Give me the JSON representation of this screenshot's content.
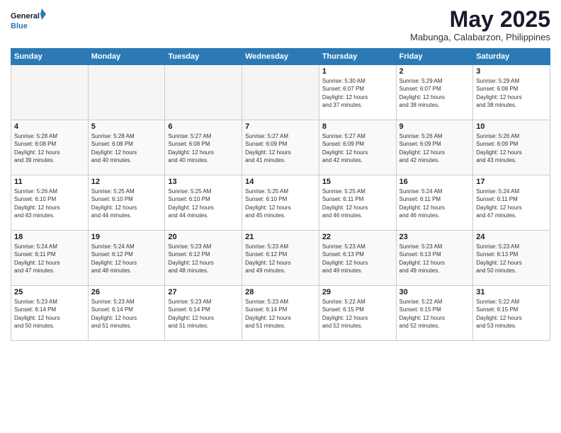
{
  "logo": {
    "line1": "General",
    "line2": "Blue"
  },
  "title": "May 2025",
  "location": "Mabunga, Calabarzon, Philippines",
  "weekdays": [
    "Sunday",
    "Monday",
    "Tuesday",
    "Wednesday",
    "Thursday",
    "Friday",
    "Saturday"
  ],
  "weeks": [
    [
      {
        "day": "",
        "info": ""
      },
      {
        "day": "",
        "info": ""
      },
      {
        "day": "",
        "info": ""
      },
      {
        "day": "",
        "info": ""
      },
      {
        "day": "1",
        "info": "Sunrise: 5:30 AM\nSunset: 6:07 PM\nDaylight: 12 hours\nand 37 minutes."
      },
      {
        "day": "2",
        "info": "Sunrise: 5:29 AM\nSunset: 6:07 PM\nDaylight: 12 hours\nand 38 minutes."
      },
      {
        "day": "3",
        "info": "Sunrise: 5:29 AM\nSunset: 6:08 PM\nDaylight: 12 hours\nand 38 minutes."
      }
    ],
    [
      {
        "day": "4",
        "info": "Sunrise: 5:28 AM\nSunset: 6:08 PM\nDaylight: 12 hours\nand 39 minutes."
      },
      {
        "day": "5",
        "info": "Sunrise: 5:28 AM\nSunset: 6:08 PM\nDaylight: 12 hours\nand 40 minutes."
      },
      {
        "day": "6",
        "info": "Sunrise: 5:27 AM\nSunset: 6:08 PM\nDaylight: 12 hours\nand 40 minutes."
      },
      {
        "day": "7",
        "info": "Sunrise: 5:27 AM\nSunset: 6:09 PM\nDaylight: 12 hours\nand 41 minutes."
      },
      {
        "day": "8",
        "info": "Sunrise: 5:27 AM\nSunset: 6:09 PM\nDaylight: 12 hours\nand 42 minutes."
      },
      {
        "day": "9",
        "info": "Sunrise: 5:26 AM\nSunset: 6:09 PM\nDaylight: 12 hours\nand 42 minutes."
      },
      {
        "day": "10",
        "info": "Sunrise: 5:26 AM\nSunset: 6:09 PM\nDaylight: 12 hours\nand 43 minutes."
      }
    ],
    [
      {
        "day": "11",
        "info": "Sunrise: 5:26 AM\nSunset: 6:10 PM\nDaylight: 12 hours\nand 43 minutes."
      },
      {
        "day": "12",
        "info": "Sunrise: 5:25 AM\nSunset: 6:10 PM\nDaylight: 12 hours\nand 44 minutes."
      },
      {
        "day": "13",
        "info": "Sunrise: 5:25 AM\nSunset: 6:10 PM\nDaylight: 12 hours\nand 44 minutes."
      },
      {
        "day": "14",
        "info": "Sunrise: 5:25 AM\nSunset: 6:10 PM\nDaylight: 12 hours\nand 45 minutes."
      },
      {
        "day": "15",
        "info": "Sunrise: 5:25 AM\nSunset: 6:11 PM\nDaylight: 12 hours\nand 46 minutes."
      },
      {
        "day": "16",
        "info": "Sunrise: 5:24 AM\nSunset: 6:11 PM\nDaylight: 12 hours\nand 46 minutes."
      },
      {
        "day": "17",
        "info": "Sunrise: 5:24 AM\nSunset: 6:11 PM\nDaylight: 12 hours\nand 47 minutes."
      }
    ],
    [
      {
        "day": "18",
        "info": "Sunrise: 5:24 AM\nSunset: 6:11 PM\nDaylight: 12 hours\nand 47 minutes."
      },
      {
        "day": "19",
        "info": "Sunrise: 5:24 AM\nSunset: 6:12 PM\nDaylight: 12 hours\nand 48 minutes."
      },
      {
        "day": "20",
        "info": "Sunrise: 5:23 AM\nSunset: 6:12 PM\nDaylight: 12 hours\nand 48 minutes."
      },
      {
        "day": "21",
        "info": "Sunrise: 5:23 AM\nSunset: 6:12 PM\nDaylight: 12 hours\nand 49 minutes."
      },
      {
        "day": "22",
        "info": "Sunrise: 5:23 AM\nSunset: 6:13 PM\nDaylight: 12 hours\nand 49 minutes."
      },
      {
        "day": "23",
        "info": "Sunrise: 5:23 AM\nSunset: 6:13 PM\nDaylight: 12 hours\nand 49 minutes."
      },
      {
        "day": "24",
        "info": "Sunrise: 5:23 AM\nSunset: 6:13 PM\nDaylight: 12 hours\nand 50 minutes."
      }
    ],
    [
      {
        "day": "25",
        "info": "Sunrise: 5:23 AM\nSunset: 6:14 PM\nDaylight: 12 hours\nand 50 minutes."
      },
      {
        "day": "26",
        "info": "Sunrise: 5:23 AM\nSunset: 6:14 PM\nDaylight: 12 hours\nand 51 minutes."
      },
      {
        "day": "27",
        "info": "Sunrise: 5:23 AM\nSunset: 6:14 PM\nDaylight: 12 hours\nand 51 minutes."
      },
      {
        "day": "28",
        "info": "Sunrise: 5:23 AM\nSunset: 6:14 PM\nDaylight: 12 hours\nand 51 minutes."
      },
      {
        "day": "29",
        "info": "Sunrise: 5:22 AM\nSunset: 6:15 PM\nDaylight: 12 hours\nand 52 minutes."
      },
      {
        "day": "30",
        "info": "Sunrise: 5:22 AM\nSunset: 6:15 PM\nDaylight: 12 hours\nand 52 minutes."
      },
      {
        "day": "31",
        "info": "Sunrise: 5:22 AM\nSunset: 6:15 PM\nDaylight: 12 hours\nand 53 minutes."
      }
    ]
  ]
}
